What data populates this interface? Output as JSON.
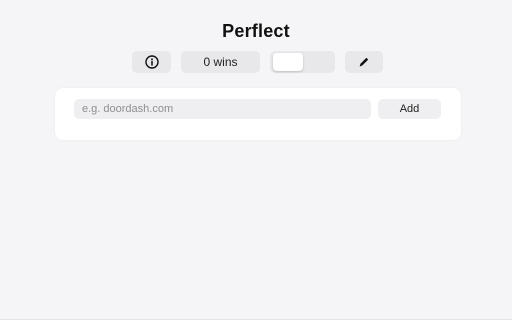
{
  "app": {
    "title": "Perflect"
  },
  "toolbar": {
    "info_icon": "info-circle-icon",
    "wins_label": "0 wins",
    "toggle_state": "off",
    "edit_icon": "pencil-icon"
  },
  "add_site": {
    "input_placeholder": "e.g. doordash.com",
    "input_value": "",
    "add_label": "Add"
  },
  "colors": {
    "background": "#f5f5f7",
    "control_bg": "#e8e8ea",
    "card_bg": "#ffffff",
    "text": "#111111"
  }
}
